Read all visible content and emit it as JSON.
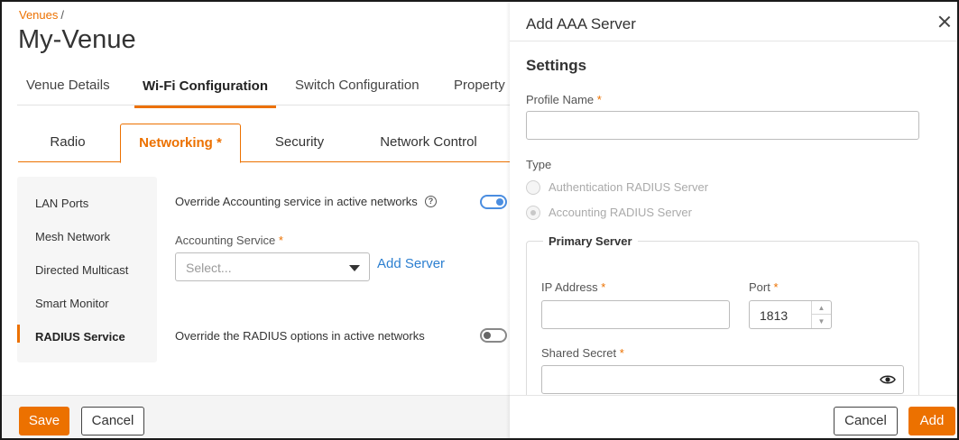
{
  "breadcrumb": {
    "link": "Venues",
    "separator": "/"
  },
  "page": {
    "title": "My-Venue"
  },
  "top_tabs": [
    {
      "label": "Venue Details"
    },
    {
      "label": "Wi-Fi Configuration",
      "active": true
    },
    {
      "label": "Switch Configuration"
    },
    {
      "label": "Property"
    }
  ],
  "sub_tabs": [
    {
      "label": "Radio"
    },
    {
      "label": "Networking *",
      "active": true
    },
    {
      "label": "Security"
    },
    {
      "label": "Network Control"
    }
  ],
  "side_nav": [
    {
      "label": "LAN Ports"
    },
    {
      "label": "Mesh Network"
    },
    {
      "label": "Directed Multicast"
    },
    {
      "label": "Smart Monitor"
    },
    {
      "label": "RADIUS Service",
      "active": true
    }
  ],
  "settings": {
    "override_accounting_label": "Override Accounting service in active networks",
    "override_accounting_on": true,
    "accounting_service_label": "Accounting Service",
    "required_mark": "*",
    "accounting_placeholder": "Select...",
    "add_server_link": "Add Server",
    "override_radius_label": "Override the RADIUS options in active networks",
    "override_radius_on": false
  },
  "footer": {
    "save": "Save",
    "cancel": "Cancel"
  },
  "drawer": {
    "title": "Add AAA Server",
    "section_title": "Settings",
    "profile_name_label": "Profile Name",
    "profile_name_value": "",
    "type_label": "Type",
    "type_options": [
      {
        "label": "Authentication RADIUS Server",
        "checked": false
      },
      {
        "label": "Accounting RADIUS Server",
        "checked": true
      }
    ],
    "primary_server_legend": "Primary Server",
    "ip_label": "IP Address",
    "ip_value": "",
    "port_label": "Port",
    "port_value": "1813",
    "secret_label": "Shared Secret",
    "secret_value": "",
    "cancel": "Cancel",
    "add": "Add"
  },
  "colors": {
    "accent": "#ec7100",
    "link": "#2c7fd0",
    "toggle_on": "#4a8de0"
  }
}
